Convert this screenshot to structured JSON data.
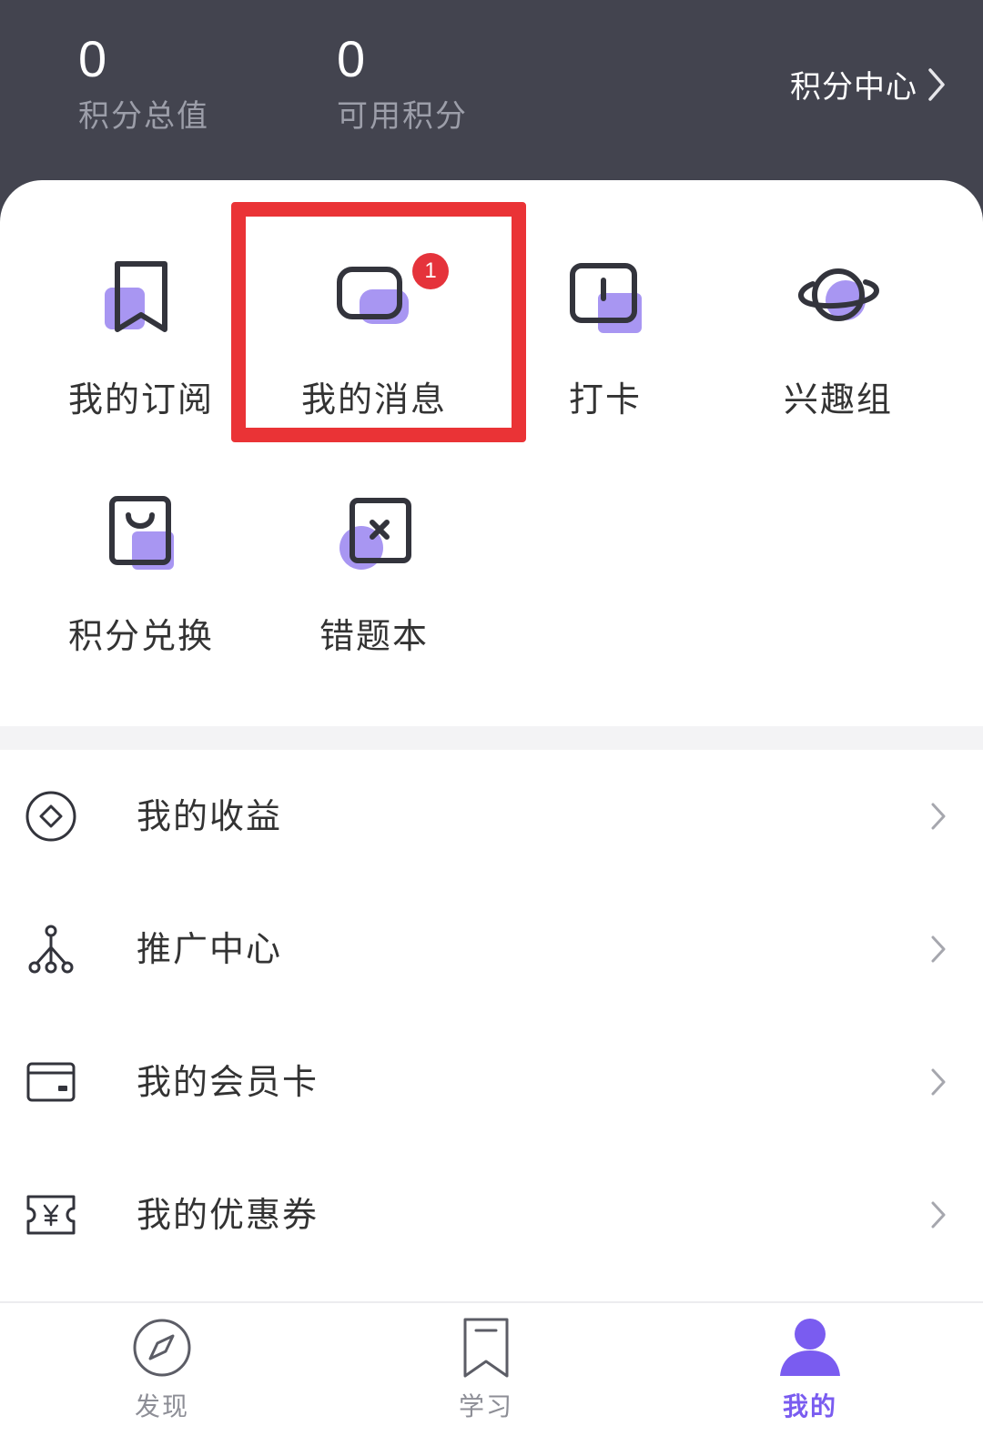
{
  "header": {
    "stats": [
      {
        "value": "0",
        "label": "积分总值"
      },
      {
        "value": "0",
        "label": "可用积分"
      }
    ],
    "points_center_label": "积分中心",
    "points_center_icon": "chevron-right-icon"
  },
  "grid": {
    "items": [
      {
        "label": "我的订阅",
        "icon": "bookmark-icon"
      },
      {
        "label": "我的消息",
        "icon": "message-bubble-icon",
        "badge": "1",
        "highlighted": true
      },
      {
        "label": "打卡",
        "icon": "check-in-icon"
      },
      {
        "label": "兴趣组",
        "icon": "planet-icon"
      },
      {
        "label": "积分兑换",
        "icon": "shopping-bag-icon"
      },
      {
        "label": "错题本",
        "icon": "wrong-answer-book-icon"
      }
    ]
  },
  "list": {
    "items": [
      {
        "label": "我的收益",
        "icon": "diamond-coin-icon"
      },
      {
        "label": "推广中心",
        "icon": "network-tree-icon"
      },
      {
        "label": "我的会员卡",
        "icon": "card-wallet-icon"
      },
      {
        "label": "我的优惠券",
        "icon": "yen-coupon-icon"
      }
    ]
  },
  "bottom_nav": {
    "tabs": [
      {
        "label": "发现",
        "icon": "compass-icon",
        "active": false
      },
      {
        "label": "学习",
        "icon": "bookmark-tab-icon",
        "active": false
      },
      {
        "label": "我的",
        "icon": "user-icon",
        "active": true
      }
    ]
  },
  "colors": {
    "header_bg": "#43444f",
    "accent": "#7a5cf0",
    "icon_tint": "#a896f2",
    "badge": "#e5333b",
    "highlight_box": "#ea3336"
  }
}
